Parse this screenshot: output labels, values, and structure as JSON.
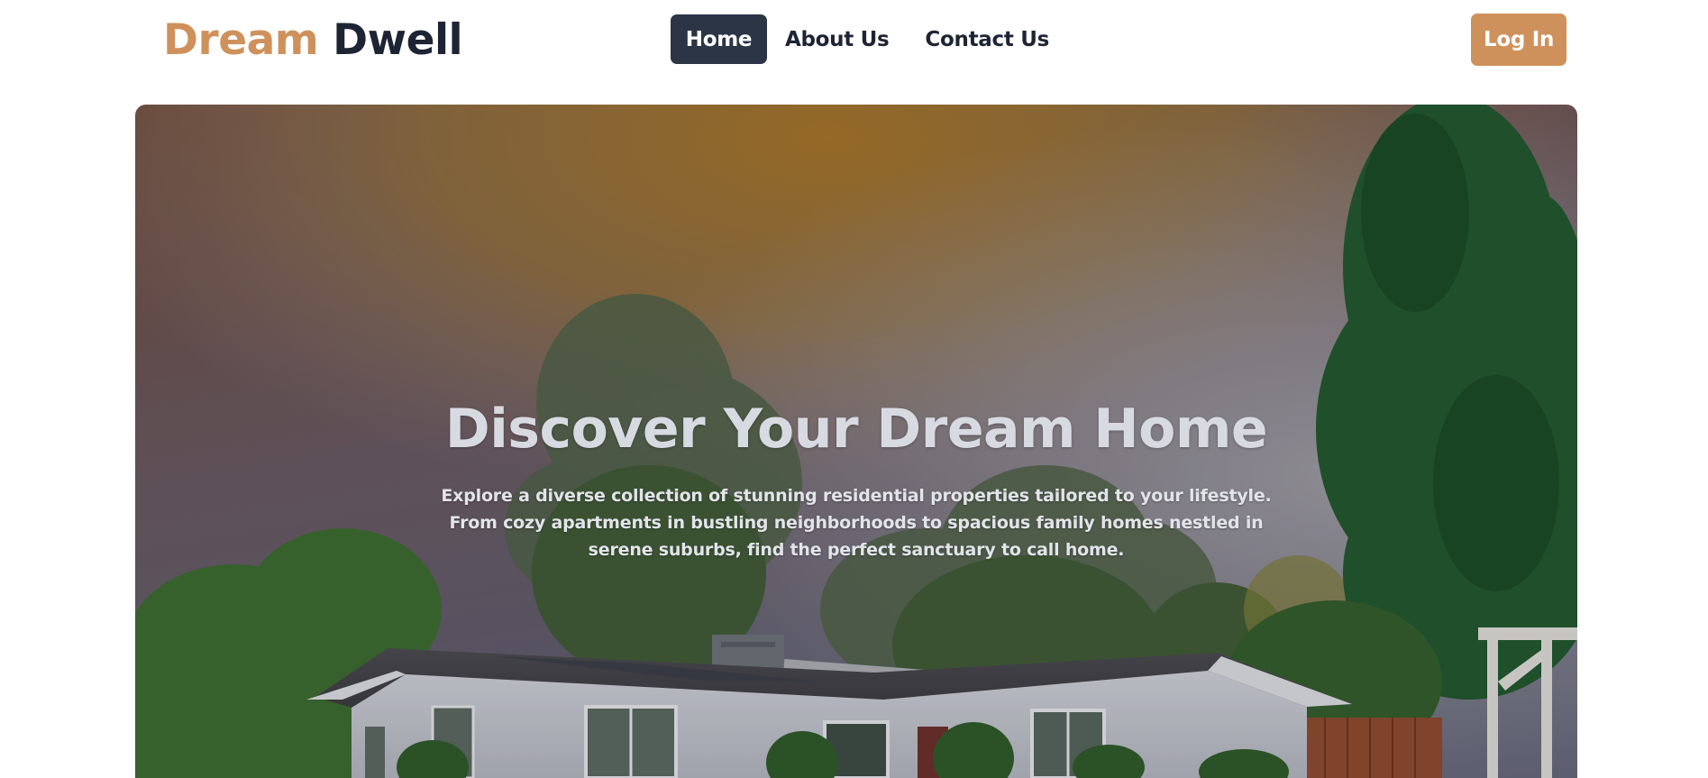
{
  "header": {
    "logo": {
      "first": "Dream",
      "second": "Dwell"
    },
    "nav": [
      {
        "label": "Home",
        "active": true
      },
      {
        "label": "About Us",
        "active": false
      },
      {
        "label": "Contact Us",
        "active": false
      }
    ],
    "login_label": "Log In"
  },
  "hero": {
    "title": "Discover Your Dream Home",
    "description": "Explore a diverse collection of stunning residential properties tailored to your lifestyle. From cozy apartments in bustling neighborhoods to spacious family homes nestled in serene suburbs, find the perfect sanctuary to call home."
  },
  "colors": {
    "brand_accent": "#cf915c",
    "brand_dark": "#1d2434",
    "nav_active_bg": "#2c3546",
    "text_white": "#ffffff"
  }
}
